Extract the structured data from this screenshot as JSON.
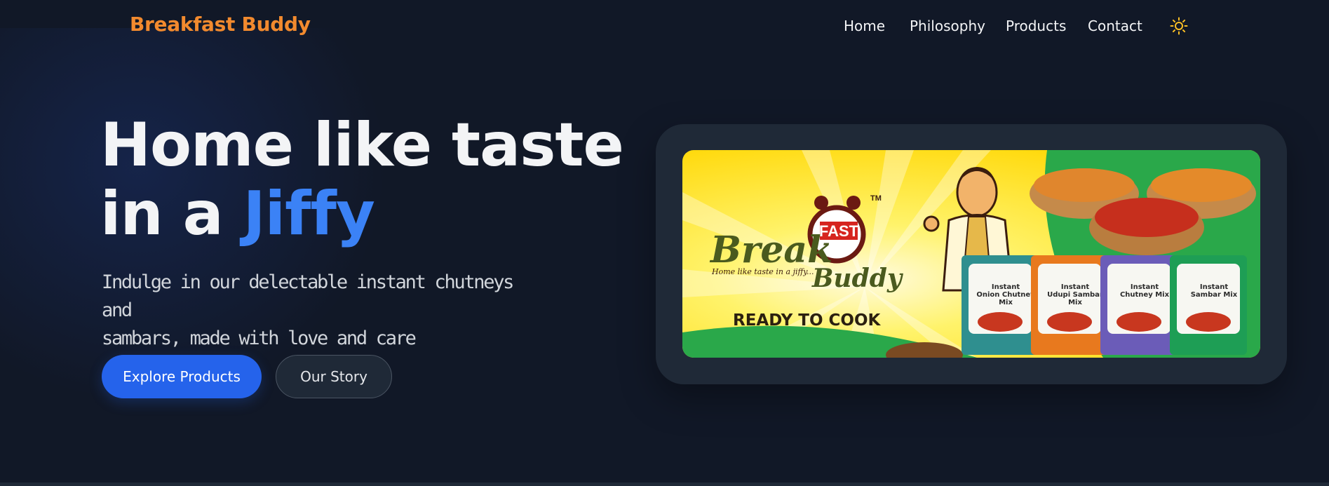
{
  "nav": {
    "brand": "Breakfast Buddy",
    "links": [
      "Home",
      "Philosophy",
      "Products",
      "Contact"
    ],
    "theme_icon": "sun-icon"
  },
  "hero": {
    "headline_line1": "Home like taste",
    "headline_line2_prefix": "in a ",
    "headline_accent": "Jiffy",
    "subheading_line1": "Indulge in our delectable instant chutneys and",
    "subheading_line2": "sambars, made with love and care",
    "primary_button": "Explore Products",
    "secondary_button": "Our Story"
  },
  "banner": {
    "logo_break": "Break",
    "logo_fast": "FAST",
    "logo_buddy": "Buddy",
    "tm": "TM",
    "tagline": "Home like taste in a jiffy...",
    "ready": "READY TO COOK",
    "packs": [
      {
        "line1": "Instant",
        "line2": "Onion Chutney",
        "line3": "Mix",
        "color": "#2f8f8f"
      },
      {
        "line1": "Instant",
        "line2": "Udupi Sambar",
        "line3": "Mix",
        "color": "#e8791e"
      },
      {
        "line1": "Instant",
        "line2": "Chutney Mix",
        "line3": "",
        "color": "#6b5cb8"
      },
      {
        "line1": "Instant",
        "line2": "Sambar Mix",
        "line3": "",
        "color": "#1e9e55"
      }
    ]
  },
  "colors": {
    "background": "#111827",
    "brand": "#f28a2e",
    "accent": "#3b82f6",
    "primary_button": "#2563eb",
    "card": "#1f2937"
  }
}
